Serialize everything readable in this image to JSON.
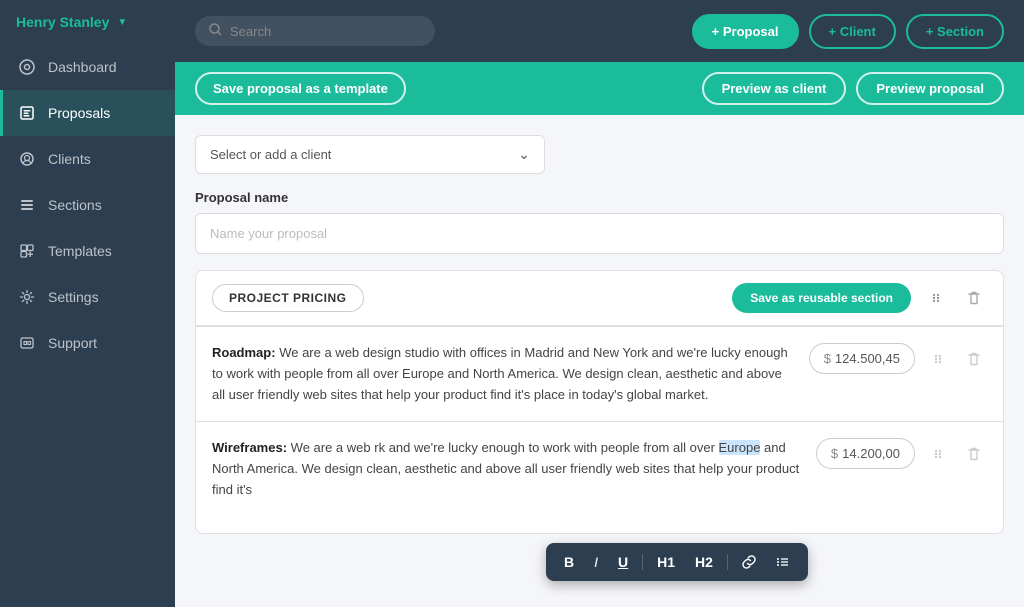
{
  "sidebar": {
    "user": {
      "name": "Henry Stanley"
    },
    "items": [
      {
        "id": "dashboard",
        "label": "Dashboard",
        "icon": "○"
      },
      {
        "id": "proposals",
        "label": "Proposals",
        "icon": "▦",
        "active": true
      },
      {
        "id": "clients",
        "label": "Clients",
        "icon": "⊙"
      },
      {
        "id": "sections",
        "label": "Sections",
        "icon": "☰"
      },
      {
        "id": "templates",
        "label": "Templates",
        "icon": "⊞"
      },
      {
        "id": "settings",
        "label": "Settings",
        "icon": "⚙"
      },
      {
        "id": "support",
        "label": "Support",
        "icon": "🎁"
      }
    ]
  },
  "topbar": {
    "search_placeholder": "Search",
    "btn_proposal": "+ Proposal",
    "btn_client": "+ Client",
    "btn_section": "+ Section"
  },
  "action_bar": {
    "save_template_label": "Save proposal as a template",
    "preview_client_label": "Preview as client",
    "preview_proposal_label": "Preview proposal"
  },
  "content": {
    "client_placeholder": "Select or add a client",
    "proposal_label": "Proposal name",
    "proposal_placeholder": "Name your proposal",
    "section_title": "PROJECT PRICING",
    "save_section_label": "Save as reusable section",
    "rows": [
      {
        "id": "row1",
        "label": "Roadmap:",
        "text": " We are a web design studio with offices in Madrid and New York and we're lucky enough to work with people from all over Europe and North America. We design clean, aesthetic and above all user friendly web sites that help your product find it's place in today's global market.",
        "price": "$ 124.500,45"
      },
      {
        "id": "row2",
        "label": "Wireframes:",
        "text_before": " We are a web ",
        "text_highlight": "",
        "text_link": "rk and we're lucky enough to work with people from all over ",
        "text_highlight2": "Europe",
        "text_after": " and North America. We design clean, aesthetic and above all user friendly web sites that help your product find it's",
        "price": "$ 14.200,00"
      }
    ],
    "toolbar": {
      "bold": "B",
      "italic": "I",
      "underline": "U",
      "h1": "H1",
      "h2": "H2",
      "link": "🔗",
      "list": "≡"
    }
  }
}
